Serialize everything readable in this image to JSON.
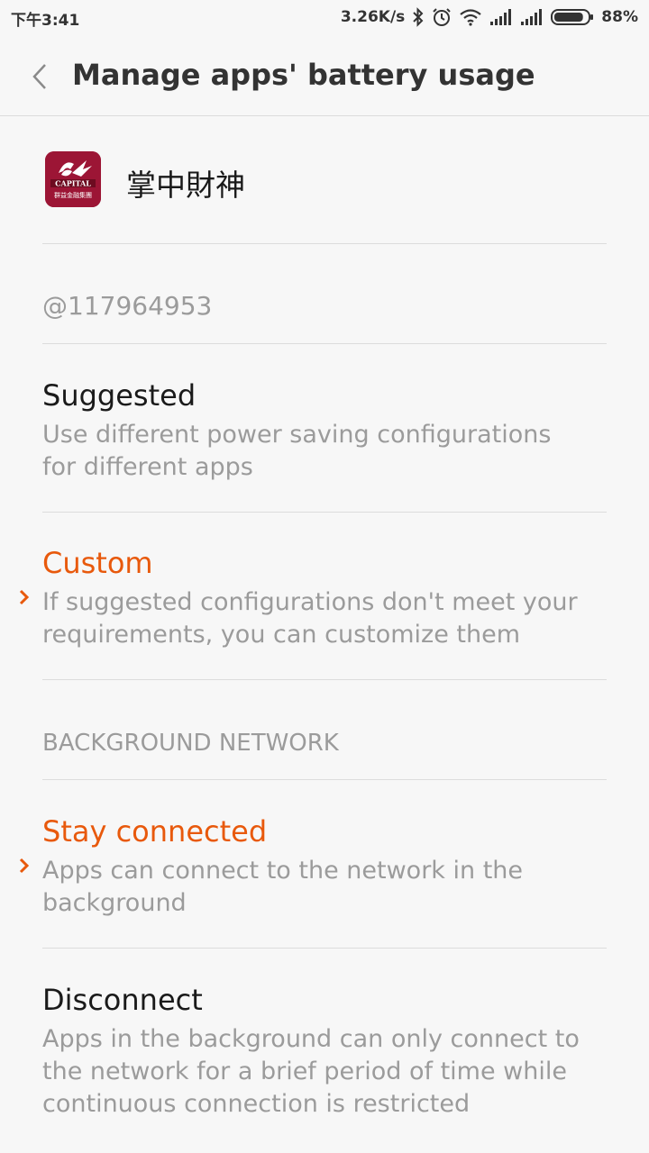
{
  "status_bar": {
    "time": "下午3:41",
    "network_speed": "3.26K/s",
    "battery_percent": "88%",
    "battery_level": 0.88,
    "icons": [
      "bluetooth-icon",
      "alarm-icon",
      "wifi-icon",
      "signal-icon",
      "signal-icon",
      "battery-icon"
    ]
  },
  "header": {
    "title": "Manage apps' battery usage"
  },
  "app": {
    "name": "掌中財神",
    "icon_text": "CAPITAL",
    "icon_subtext": "群益金融集團",
    "account": "@117964953"
  },
  "options": {
    "suggested": {
      "title": "Suggested",
      "desc": "Use different power saving configurations for different apps"
    },
    "custom": {
      "title": "Custom",
      "desc": "If suggested configurations don't meet your requirements, you can customize them"
    }
  },
  "background_network": {
    "header": "BACKGROUND NETWORK",
    "stay_connected": {
      "title": "Stay connected",
      "desc": "Apps can connect to the network in the background"
    },
    "disconnect": {
      "title": "Disconnect",
      "desc": "Apps in the background can only connect to the network for a brief period of time while continuous connection is restricted"
    }
  },
  "colors": {
    "accent": "#e8590c",
    "text_primary": "#1a1a1a",
    "text_secondary": "#9b9b9b",
    "background": "#f7f7f7",
    "divider": "#dcdcdc"
  }
}
